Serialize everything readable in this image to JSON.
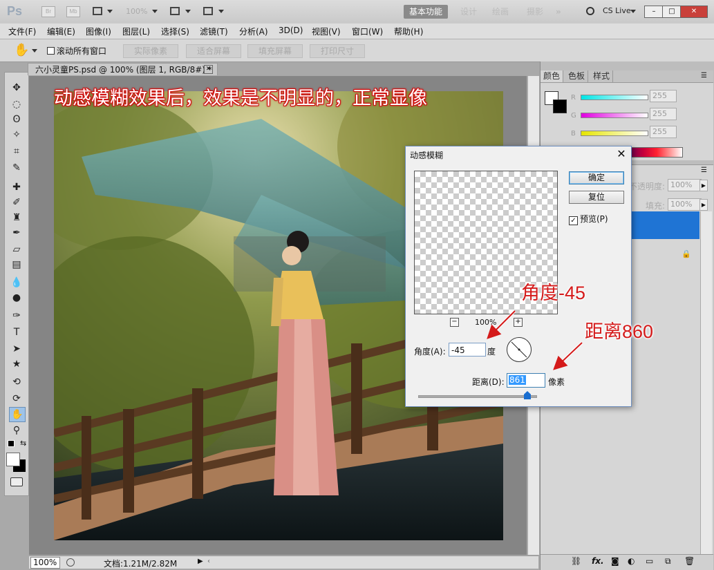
{
  "app": {
    "logo": "Ps",
    "bridge_btn": "Br",
    "minibridge_btn": "Mb",
    "zoom": "100%",
    "workspaces": [
      "基本功能",
      "设计",
      "绘画",
      "摄影"
    ],
    "more": "»",
    "cs_live": "CS Live"
  },
  "window_controls": [
    "–",
    "□",
    "✕"
  ],
  "menu": [
    "文件(F)",
    "编辑(E)",
    "图像(I)",
    "图层(L)",
    "选择(S)",
    "滤镜(T)",
    "分析(A)",
    "3D(D)",
    "视图(V)",
    "窗口(W)",
    "帮助(H)"
  ],
  "options": {
    "scroll_all": "滚动所有窗口",
    "buttons": [
      "实际像素",
      "适合屏幕",
      "填充屏幕",
      "打印尺寸"
    ]
  },
  "document": {
    "tab_title": "六小灵童PS.psd @ 100% (图层 1, RGB/8#) *",
    "zoom": "100%",
    "info": "文档:1.21M/2.82M"
  },
  "annotations": {
    "title": "动感模糊效果后，效果是不明显的，正常显像",
    "angle_note": "角度-45",
    "distance_note": "距离860"
  },
  "color_panel": {
    "tabs": [
      "颜色",
      "色板",
      "样式"
    ],
    "channels": [
      {
        "label": "R",
        "value": "255",
        "color": "#00e5e5"
      },
      {
        "label": "G",
        "value": "255",
        "color": "#e000e0"
      },
      {
        "label": "B",
        "value": "255",
        "color": "#e5e500"
      }
    ]
  },
  "layers_panel": {
    "opacity_label": "不透明度:",
    "opacity_value": "100%",
    "fill_label": "填充:",
    "fill_value": "100%"
  },
  "dialog": {
    "title": "动感模糊",
    "ok": "确定",
    "reset": "复位",
    "preview_label": "预览(P)",
    "preview_checked": true,
    "zoom": "100%",
    "angle_label": "角度(A):",
    "angle_value": "-45",
    "angle_unit": "度",
    "distance_label": "距离(D):",
    "distance_value": "861",
    "distance_unit": "像素"
  },
  "colors": {
    "accent_selection": "#1f74d4",
    "annotation_red": "#d41a1a"
  }
}
